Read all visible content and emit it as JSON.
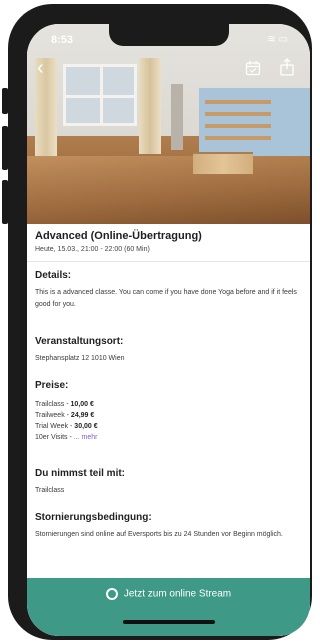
{
  "status_bar": {
    "time": "8:53",
    "icons": "≋ ▭"
  },
  "nav": {
    "back_glyph": "‹"
  },
  "event": {
    "title": "Advanced (Online-Übertragung)",
    "datetime": "Heute, 15.03., 21:00 - 22:00 (60 Min)"
  },
  "details": {
    "heading": "Details:",
    "text": "This is a advanced classe. You can come if you have done Yoga before and if it feels good for you."
  },
  "location": {
    "heading": "Veranstaltungsort:",
    "address": "Stephansplatz 12 1010 Wien"
  },
  "prices": {
    "heading": "Preise:",
    "items": [
      {
        "label": "Trailclass - ",
        "value": "10,00 €"
      },
      {
        "label": "Trailweek - ",
        "value": "24,99 €"
      },
      {
        "label": "Trial Week - ",
        "value": "30,00 €"
      }
    ],
    "more_prefix": "10er Visits - ",
    "more_link": "... mehr"
  },
  "participation": {
    "heading": "Du nimmst teil mit:",
    "value": "Trailclass"
  },
  "cancellation": {
    "heading": "Stornierungsbedingung:",
    "text": "Stornierungen sind online auf Eversports bis zu 24 Stunden vor Beginn möglich."
  },
  "cta": {
    "label": "Jetzt zum online Stream"
  },
  "colors": {
    "cta_bg": "#3e9a86",
    "link": "#7b5fd6"
  },
  "icons": {
    "back": "chevron-left-icon",
    "calendar": "calendar-icon",
    "share": "share-icon",
    "stream": "stream-icon"
  }
}
